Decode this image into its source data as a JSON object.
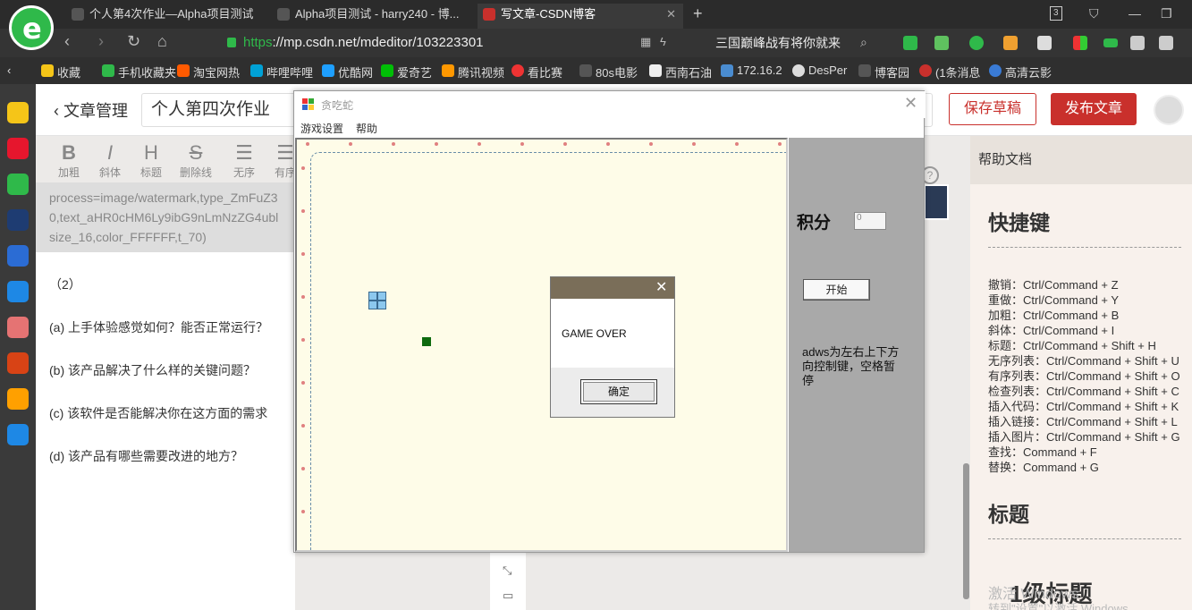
{
  "browser": {
    "tabs": [
      {
        "label": "个人第4次作业—Alpha项目测试"
      },
      {
        "label": "Alpha项目测试 - harry240 - 博..."
      },
      {
        "label": "写文章-CSDN博客"
      }
    ],
    "tab_count": "3",
    "url_scheme": "https",
    "url_rest": "://mp.csdn.net/mdeditor/103223301",
    "search_text": "三国巅峰战有将你就来",
    "bookmarks": [
      "收藏",
      "手机收藏夹",
      "淘宝网热",
      "哔哩哔哩",
      "优酷网",
      "爱奇艺",
      "腾讯视频",
      "看比赛",
      "80s电影",
      "西南石油",
      "172.16.2",
      "DesPer",
      "博客园",
      "(1条消息",
      "高清云影"
    ]
  },
  "editor": {
    "back_label": "文章管理",
    "title": "个人第四次作业",
    "save_draft": "保存草稿",
    "publish": "发布文章",
    "toolbar": [
      {
        "glyph": "B",
        "label": "加粗"
      },
      {
        "glyph": "I",
        "label": "斜体"
      },
      {
        "glyph": "H",
        "label": "标题"
      },
      {
        "glyph": "S",
        "label": "删除线"
      },
      {
        "glyph": "☰",
        "label": "无序"
      },
      {
        "glyph": "☰",
        "label": "有序"
      }
    ],
    "code_lines": [
      "process=image/watermark,type_ZmFuZ3",
      "0,text_aHR0cHM6Ly9ibG9nLmNzZG4ubl",
      "size_16,color_FFFFFF,t_70)"
    ],
    "paragraphs": [
      "（2）",
      "(a)   上手体验感觉如何？能否正常运行？",
      "(b)   该产品解决了什么样的关键问题？",
      "(c)   该软件是否能解决你在这方面的需求",
      "(d)   该产品有哪些需要改进的地方？"
    ]
  },
  "help": {
    "header": "帮助文档",
    "shortcuts_title": "快捷键",
    "shortcuts": [
      "撤销：Ctrl/Command + Z",
      "重做：Ctrl/Command + Y",
      "加粗：Ctrl/Command + B",
      "斜体：Ctrl/Command + I",
      "标题：Ctrl/Command + Shift + H",
      "无序列表：Ctrl/Command + Shift + U",
      "有序列表：Ctrl/Command + Shift + O",
      "检查列表：Ctrl/Command + Shift + C",
      "插入代码：Ctrl/Command + Shift + K",
      "插入链接：Ctrl/Command + Shift + L",
      "插入图片：Ctrl/Command + Shift + G",
      "查找：Command + F",
      "替换：Command + G"
    ],
    "headings_title": "标题",
    "h1_sample": "1级标题",
    "watermark_1": "激活 Windows",
    "watermark_2": "转到\"设置\"以激活 Windows"
  },
  "snake_game": {
    "window_title": "贪吃蛇",
    "menu": [
      "游戏设置",
      "帮助"
    ],
    "score_label": "积分",
    "score_value": "0",
    "start_button": "开始",
    "instructions": "adws为左右上下方向控制键，空格暂停"
  },
  "dialog": {
    "message": "GAME OVER",
    "ok_button": "确定"
  },
  "colors": {
    "brand_red": "#c9302c",
    "browser_green": "#2fb94a",
    "field_bg": "#fefce8",
    "snake_blue": "#8cc8ee",
    "food_green": "#0e6a0e"
  }
}
